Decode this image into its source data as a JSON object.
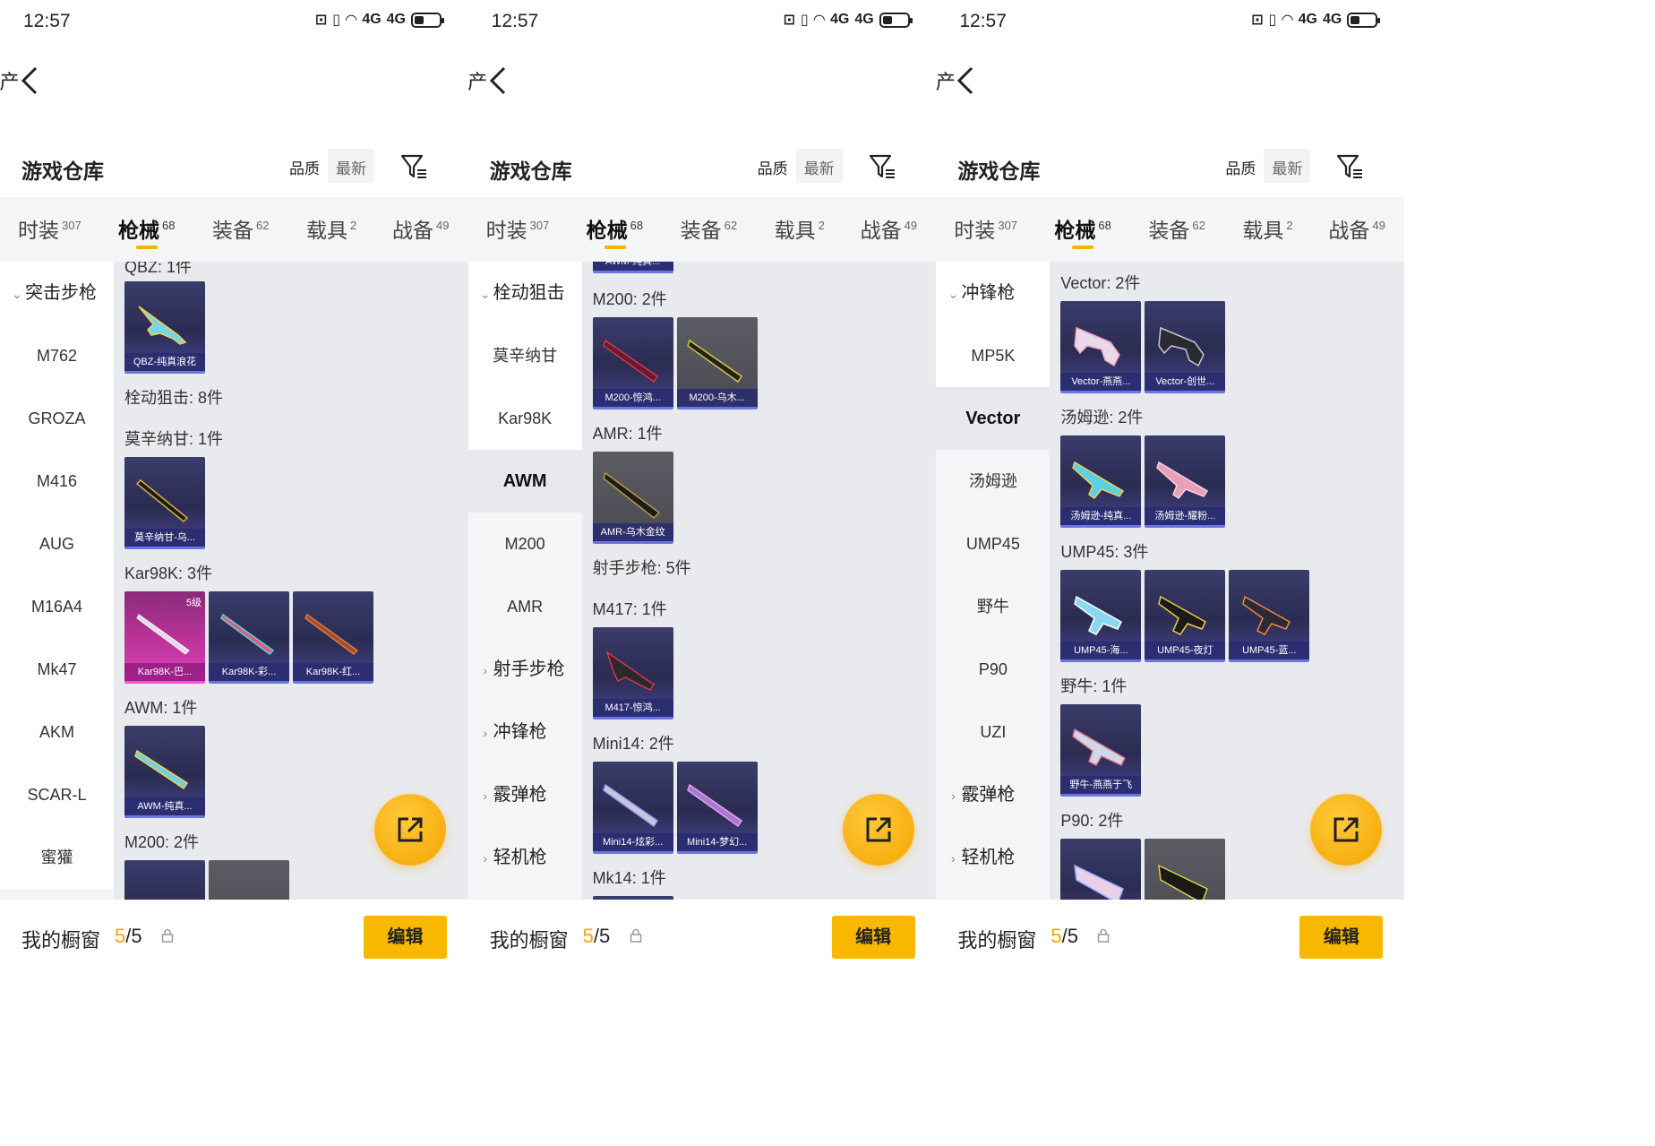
{
  "status": {
    "time": "12:57",
    "signal": "4G",
    "network": "4G"
  },
  "nav": {
    "title": "资产"
  },
  "section": {
    "title": "游戏仓库",
    "sort_quality": "品质",
    "sort_latest": "最新"
  },
  "tabs": [
    {
      "label": "时装",
      "count": "307"
    },
    {
      "label": "枪械",
      "count": "68"
    },
    {
      "label": "装备",
      "count": "62"
    },
    {
      "label": "载具",
      "count": "2"
    },
    {
      "label": "战备",
      "count": "49"
    }
  ],
  "footer": {
    "label": "我的橱窗",
    "current": "5",
    "total": "/5",
    "edit": "编辑"
  },
  "screens": [
    {
      "sidebar": {
        "group": "突击步枪",
        "items": [
          "M762",
          "GROZA",
          "M416",
          "AUG",
          "M16A4",
          "Mk47",
          "AKM",
          "SCAR-L",
          "蜜獾"
        ]
      },
      "content": {
        "top_partial": "QBZ: 1件",
        "qbz_card": "QBZ-纯真浪花",
        "cat_bolt": "栓动狙击: 8件",
        "mosin_label": "莫辛纳甘: 1件",
        "mosin_card": "莫辛纳甘-乌...",
        "kar_label": "Kar98K: 3件",
        "kar_cards": [
          "Kar98K-巴...",
          "Kar98K-彩...",
          "Kar98K-红..."
        ],
        "kar_level": "5级",
        "awm_label": "AWM: 1件",
        "awm_card": "AWM-纯真...",
        "m200_label": "M200: 2件"
      }
    },
    {
      "sidebar": {
        "group": "栓动狙击",
        "items": [
          "莫辛纳甘",
          "Kar98K",
          "AWM",
          "M200",
          "AMR"
        ],
        "groups_closed": [
          "射手步枪",
          "冲锋枪",
          "霰弹枪",
          "轻机枪"
        ]
      },
      "content": {
        "top_partial": "AWM-纯真...",
        "m200_label": "M200: 2件",
        "m200_cards": [
          "M200-惊鸿...",
          "M200-乌木..."
        ],
        "amr_label": "AMR: 1件",
        "amr_card": "AMR-乌木金纹",
        "cat_dmr": "射手步枪: 5件",
        "m417_label": "M417: 1件",
        "m417_card": "M417-惊鸿...",
        "mini_label": "Mini14: 2件",
        "mini_cards": [
          "Mini14-炫彩...",
          "Mini14-梦幻..."
        ],
        "mk14_label": "Mk14: 1件"
      }
    },
    {
      "sidebar": {
        "group": "冲锋枪",
        "items": [
          "MP5K",
          "Vector",
          "汤姆逊",
          "UMP45",
          "野牛",
          "P90",
          "UZI"
        ],
        "groups_closed": [
          "霰弹枪",
          "轻机枪"
        ]
      },
      "content": {
        "vector_label": "Vector: 2件",
        "vector_cards": [
          "Vector-燕燕...",
          "Vector-创世..."
        ],
        "thompson_label": "汤姆逊: 2件",
        "thompson_cards": [
          "汤姆逊-纯真...",
          "汤姆逊-耀粉..."
        ],
        "ump_label": "UMP45: 3件",
        "ump_cards": [
          "UMP45-海...",
          "UMP45-夜灯",
          "UMP45-蓝..."
        ],
        "bizon_label": "野牛: 1件",
        "bizon_card": "野牛-燕燕于飞",
        "p90_label": "P90: 2件"
      }
    }
  ]
}
